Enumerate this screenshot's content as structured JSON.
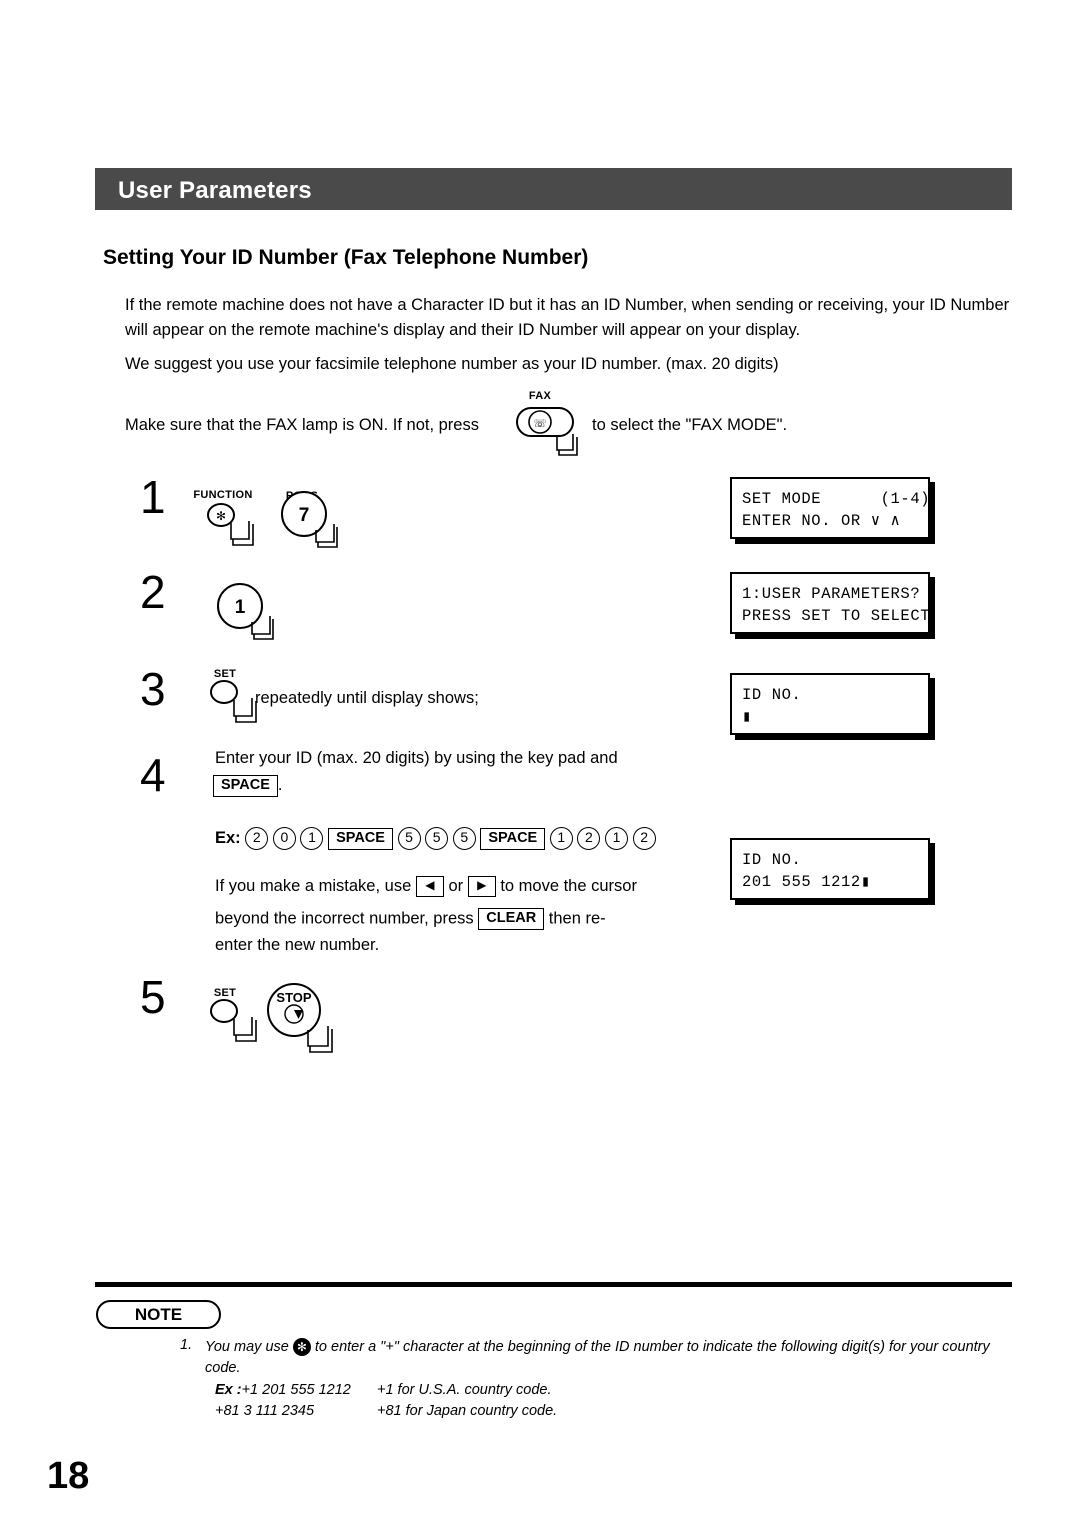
{
  "header": {
    "title": "User Parameters"
  },
  "section": {
    "title": "Setting Your ID Number (Fax Telephone Number)"
  },
  "paragraphs": {
    "p1": "If the remote machine does not have a Character ID but it has an ID Number, when sending or receiving, your ID Number will appear on the remote machine's display and their ID Number will appear on your display.",
    "p2": "We suggest you use your facsimile telephone number as your ID number. (max. 20 digits)",
    "p3_before": "Make sure that the FAX lamp is ON.  If not, press",
    "p3_after": "to select the \"FAX MODE\".",
    "fax_key_caption": "FAX"
  },
  "steps": {
    "s1": "1",
    "s2": "2",
    "s3": "3",
    "s4": "4",
    "s5": "5"
  },
  "keys": {
    "function": "FUNCTION",
    "star": "✻",
    "pqrs_caption": "PQRS",
    "seven": "7",
    "one": "1",
    "set": "SET",
    "stop": "STOP"
  },
  "step3": {
    "text": "repeatedly until display shows;"
  },
  "step4": {
    "line1": "Enter your ID (max. 20 digits) by using the key pad and",
    "space_key": "SPACE",
    "period": ".",
    "ex_label": "Ex:",
    "ex_keys": [
      "2",
      "0",
      "1",
      "SPACE",
      "5",
      "5",
      "5",
      "SPACE",
      "1",
      "2",
      "1",
      "2"
    ],
    "mistake_1": "If you make a mistake, use",
    "mistake_or": "or",
    "mistake_2": "to move the cursor",
    "mistake_3": "beyond the incorrect number, press",
    "clear_key": "CLEAR",
    "mistake_4": "then re-",
    "mistake_5": "enter the new number.",
    "arrow_left": "◀",
    "arrow_right": "▶"
  },
  "displays": {
    "d1": [
      "SET MODE      (1-4)",
      "ENTER NO. OR ∨ ∧"
    ],
    "d2": [
      "1:USER PARAMETERS?",
      "PRESS SET TO SELECT"
    ],
    "d3": [
      "ID NO.",
      "▮"
    ],
    "d4": [
      "ID NO.",
      "201 555 1212▮"
    ]
  },
  "note": {
    "badge": "NOTE",
    "number": "1.",
    "text_a": "You may use",
    "text_b": "to enter a \"+\" character at the beginning of the ID number to indicate the following digit(s) for your country code.",
    "ex_label": "Ex :",
    "ex1_left": "+1 201 555 1212",
    "ex1_right": "+1 for U.S.A. country code.",
    "ex2_left": "+81 3 111 2345",
    "ex2_right": "+81 for Japan country code."
  },
  "page_number": "18"
}
